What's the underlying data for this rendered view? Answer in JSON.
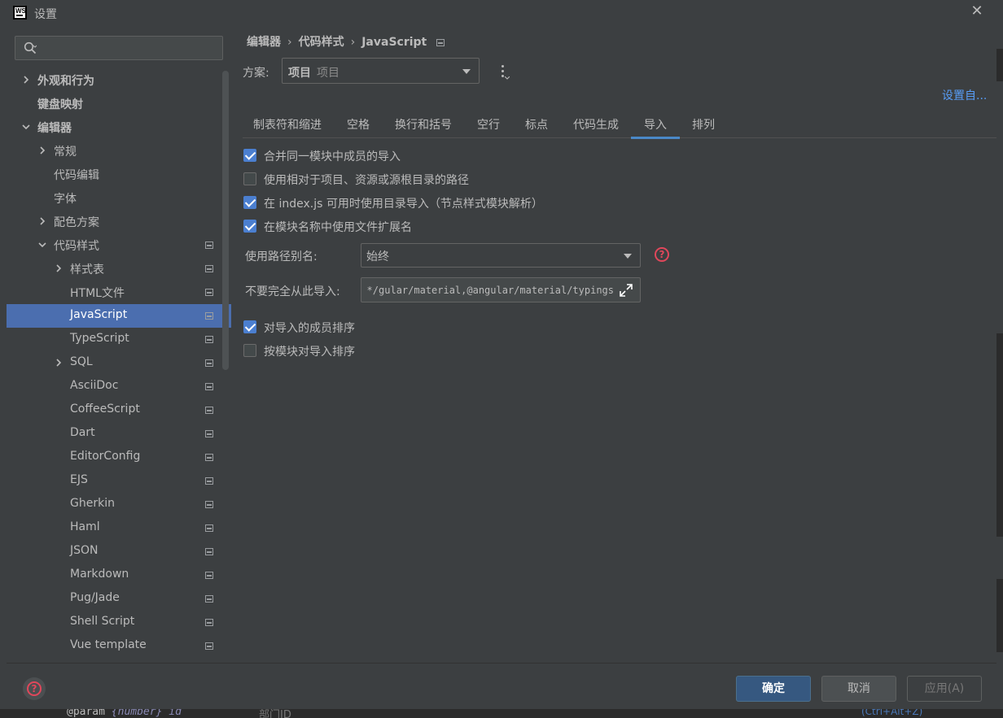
{
  "window": {
    "title": "设置",
    "app_icon_text": "WS"
  },
  "search": {
    "placeholder": "",
    "value": ""
  },
  "sidebar": {
    "items": [
      {
        "label": "外观和行为",
        "chevron": "right",
        "bold": true
      },
      {
        "label": "键盘映射",
        "chevron": "none",
        "bold": true
      },
      {
        "label": "编辑器",
        "chevron": "down",
        "bold": true
      },
      {
        "label": "常规",
        "chevron": "right"
      },
      {
        "label": "代码编辑"
      },
      {
        "label": "字体"
      },
      {
        "label": "配色方案",
        "chevron": "right"
      },
      {
        "label": "代码样式",
        "chevron": "down",
        "scheme_icon": true
      },
      {
        "label": "样式表",
        "chevron": "right",
        "scheme_icon": true
      },
      {
        "label": "HTML文件",
        "scheme_icon": true
      },
      {
        "label": "JavaScript",
        "scheme_icon": true,
        "selected": true
      },
      {
        "label": "TypeScript",
        "scheme_icon": true
      },
      {
        "label": "SQL",
        "chevron": "right",
        "scheme_icon": true
      },
      {
        "label": "AsciiDoc",
        "scheme_icon": true
      },
      {
        "label": "CoffeeScript",
        "scheme_icon": true
      },
      {
        "label": "Dart",
        "scheme_icon": true
      },
      {
        "label": "EditorConfig",
        "scheme_icon": true
      },
      {
        "label": "EJS",
        "scheme_icon": true
      },
      {
        "label": "Gherkin",
        "scheme_icon": true
      },
      {
        "label": "Haml",
        "scheme_icon": true
      },
      {
        "label": "JSON",
        "scheme_icon": true
      },
      {
        "label": "Markdown",
        "scheme_icon": true
      },
      {
        "label": "Pug/Jade",
        "scheme_icon": true
      },
      {
        "label": "Shell Script",
        "scheme_icon": true
      },
      {
        "label": "Vue template",
        "scheme_icon": true
      }
    ]
  },
  "breadcrumb": {
    "items": [
      "编辑器",
      "代码样式",
      "JavaScript"
    ]
  },
  "scheme": {
    "label": "方案:",
    "value_bold": "项目",
    "value_sub": "项目"
  },
  "set_from_link": "设置自...",
  "tabs": {
    "items": [
      "制表符和缩进",
      "空格",
      "换行和括号",
      "空行",
      "标点",
      "代码生成",
      "导入",
      "排列"
    ],
    "active": "导入"
  },
  "options": {
    "merge_imports": {
      "label": "合并同一模块中成员的导入",
      "checked": true
    },
    "relative_paths": {
      "label": "使用相对于项目、资源或源根目录的路径",
      "checked": false
    },
    "dir_import": {
      "label": "在 index.js 可用时使用目录导入（节点样式模块解析）",
      "checked": true
    },
    "file_extension": {
      "label": "在模块名称中使用文件扩展名",
      "checked": true
    },
    "sort_members": {
      "label": "对导入的成员排序",
      "checked": true
    },
    "sort_by_module": {
      "label": "按模块对导入排序",
      "checked": false
    }
  },
  "path_alias": {
    "label": "使用路径别名:",
    "value": "始终"
  },
  "exclude": {
    "label": "不要完全从此导入:",
    "value": "gular/material,@angular/material/typings/**"
  },
  "footer": {
    "ok": "确定",
    "cancel": "取消",
    "apply": "应用(A)"
  },
  "background": {
    "code_fragment_param": "@param",
    "code_fragment_type": "{number}",
    "code_fragment_id": "id",
    "code_fragment_2": "部门ID",
    "code_fragment_3": "(Ctrl+Alt+Z)"
  },
  "colors": {
    "accent": "#4b6eaf",
    "link": "#589df6",
    "help": "#e0475b",
    "ok_button": "#365880"
  }
}
